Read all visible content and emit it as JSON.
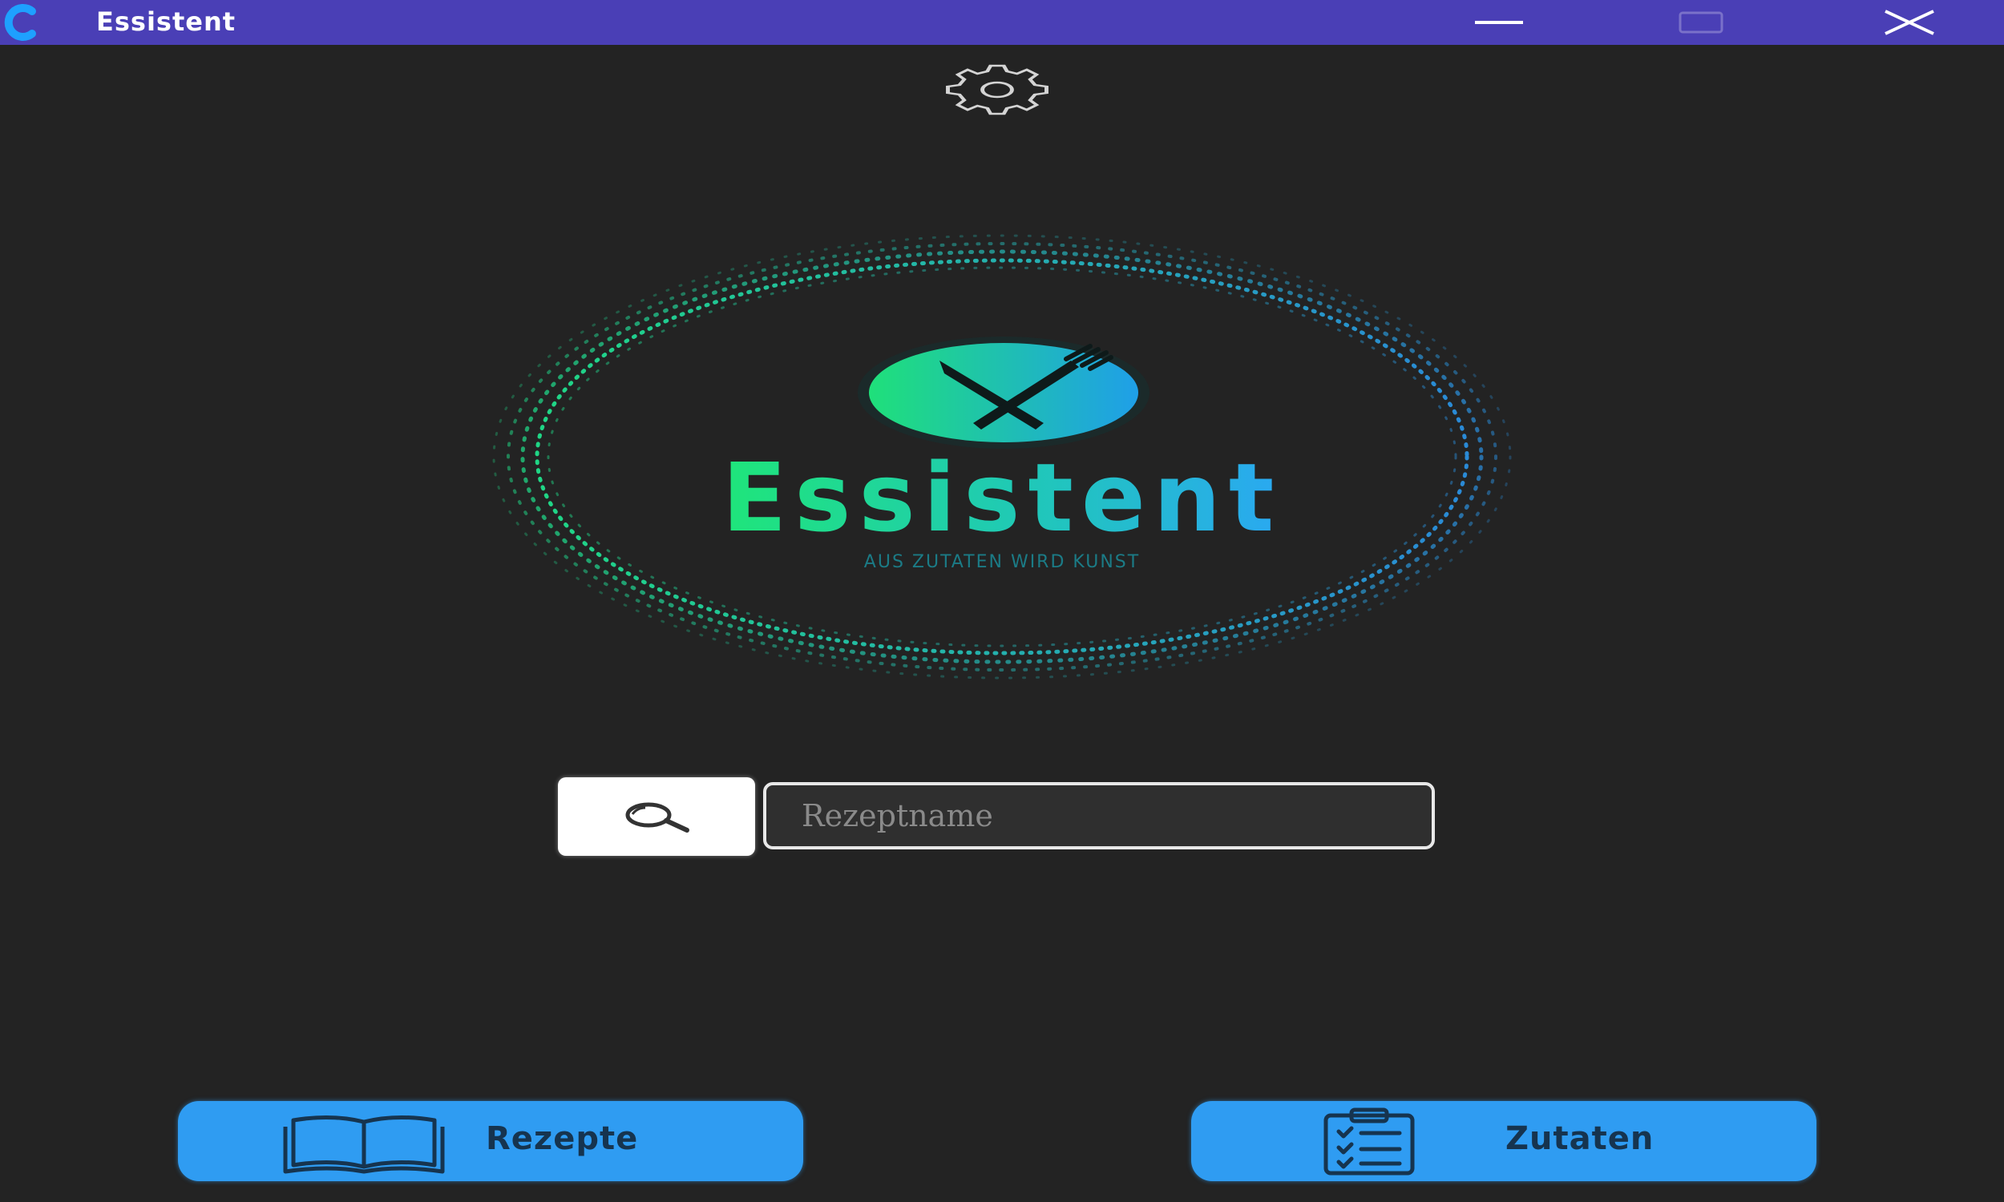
{
  "window": {
    "title": "Essistent"
  },
  "logo": {
    "name": "Essistent",
    "tagline": "AUS ZUTATEN WIRD KUNST"
  },
  "search": {
    "placeholder": "Rezeptname",
    "value": ""
  },
  "nav": {
    "recipes_label": "Rezepte",
    "ingredients_label": "Zutaten"
  },
  "colors": {
    "titlebar": "#4a3fb6",
    "background": "#232323",
    "button": "#2f9cf2",
    "logo_green": "#1fe57a",
    "logo_blue": "#2aa8f2"
  },
  "icons": {
    "settings": "gear-icon",
    "search": "magnifier-icon",
    "recipes": "open-book-icon",
    "ingredients": "clipboard-checklist-icon"
  }
}
